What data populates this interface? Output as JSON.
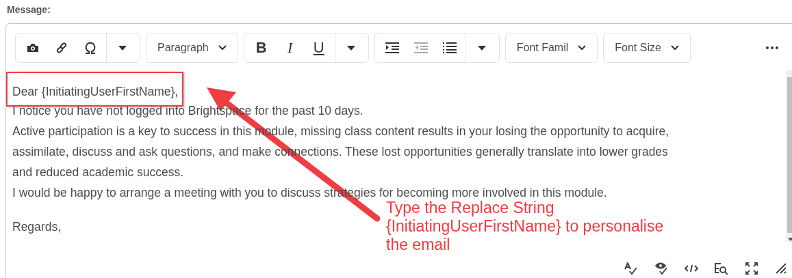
{
  "field_label": "Message:",
  "toolbar": {
    "format_buttons": [
      {
        "label": "B"
      },
      {
        "label": "I"
      },
      {
        "label": "U"
      }
    ],
    "dropdowns": [
      {
        "label": "Paragraph"
      },
      {
        "label": "Font Famil"
      },
      {
        "label": "Font Size"
      }
    ],
    "list_buttons": [
      {
        "disabled": false
      },
      {
        "disabled": true
      },
      {
        "disabled": false
      }
    ]
  },
  "body_lines": [
    {
      "text": "Dear {InitiatingUserFirstName},",
      "highlighted": true
    },
    {
      "text": "I notice you have not logged into Brightspace for the past 10 days.",
      "highlighted": false
    },
    {
      "text": "Active participation is a key to success in this module, missing class content results in your losing the opportunity to acquire,",
      "highlighted": false
    },
    {
      "text": "assimilate, discuss and ask questions, and make connections. These lost opportunities generally translate into lower grades",
      "highlighted": false
    },
    {
      "text": "and reduced academic success.",
      "highlighted": false
    },
    {
      "text": "I would be happy to arrange a meeting with you to discuss strategies for becoming more involved in this module.",
      "highlighted": false
    }
  ],
  "closing": "Regards,",
  "annotation": {
    "callout_lines": [
      "Type the Replace String",
      "{InitiatingUserFirstName} to personalise",
      "the email"
    ]
  }
}
